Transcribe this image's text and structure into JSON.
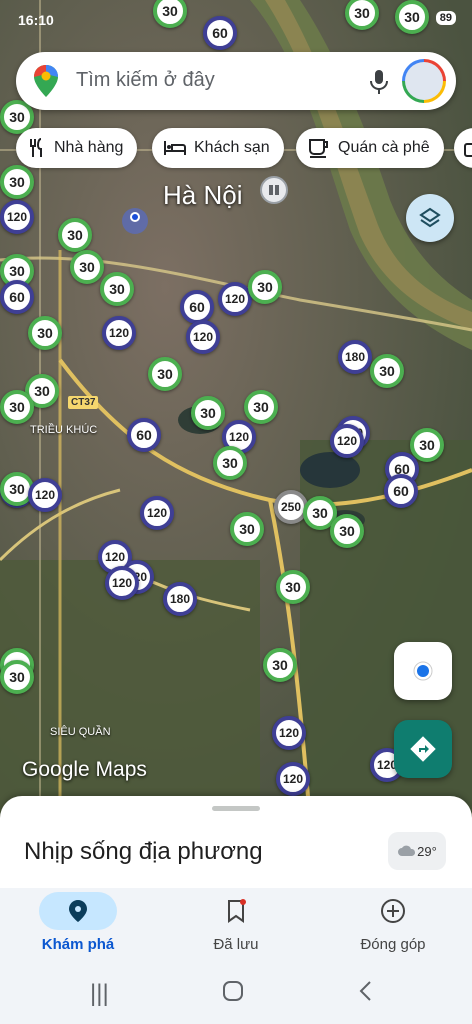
{
  "status_bar": {
    "time": "16:10",
    "battery": "89"
  },
  "search": {
    "placeholder": "Tìm kiếm ở đây"
  },
  "chips": [
    {
      "label": "Nhà hàng",
      "icon": "restaurant-icon"
    },
    {
      "label": "Khách sạn",
      "icon": "hotel-icon"
    },
    {
      "label": "Quán cà phê",
      "icon": "coffee-icon"
    }
  ],
  "map": {
    "city_label": "Hà Nội",
    "road_badge": "CT37",
    "place_labels": [
      "TRIỀU KHÚC",
      "SIÊU QUẦN"
    ],
    "logo_text": "Google Maps"
  },
  "speed_markers": [
    {
      "v": "30"
    },
    {
      "v": "60"
    },
    {
      "v": "30"
    },
    {
      "v": "30"
    },
    {
      "v": "30"
    },
    {
      "v": "30"
    },
    {
      "v": "30"
    },
    {
      "v": "120"
    },
    {
      "v": "30"
    },
    {
      "v": "30"
    },
    {
      "v": "30"
    },
    {
      "v": "60"
    },
    {
      "v": "120"
    },
    {
      "v": "30"
    },
    {
      "v": "120"
    },
    {
      "v": "30"
    },
    {
      "v": "120"
    },
    {
      "v": "180"
    },
    {
      "v": "30"
    },
    {
      "v": "30"
    },
    {
      "v": "30"
    },
    {
      "v": "120"
    },
    {
      "v": "30"
    },
    {
      "v": "60"
    },
    {
      "v": "120"
    },
    {
      "v": "30"
    },
    {
      "v": "30"
    },
    {
      "v": "60"
    },
    {
      "v": "60"
    },
    {
      "v": "30"
    },
    {
      "v": "120"
    },
    {
      "v": "120"
    },
    {
      "v": "250"
    },
    {
      "v": "30"
    },
    {
      "v": "30"
    },
    {
      "v": "30"
    },
    {
      "v": "120"
    },
    {
      "v": "180"
    },
    {
      "v": "30"
    },
    {
      "v": "120"
    },
    {
      "v": "120"
    },
    {
      "v": "120"
    },
    {
      "v": "120"
    },
    {
      "v": "30"
    },
    {
      "v": "30"
    },
    {
      "v": "30"
    },
    {
      "v": "30"
    },
    {
      "v": "120"
    },
    {
      "v": "60"
    },
    {
      "v": "120"
    },
    {
      "v": "30"
    },
    {
      "v": "120"
    }
  ],
  "bottom_sheet": {
    "title": "Nhịp sống địa phương",
    "temperature": "29°"
  },
  "nav": [
    {
      "label": "Khám phá",
      "icon": "explore-pin-icon"
    },
    {
      "label": "Đã lưu",
      "icon": "bookmark-icon"
    },
    {
      "label": "Đóng góp",
      "icon": "add-circle-icon"
    }
  ],
  "colors": {
    "speed_green": "#4caf50",
    "speed_blue": "#3f3f95",
    "accent": "#0b57d0",
    "directions": "#0f7d6f"
  }
}
